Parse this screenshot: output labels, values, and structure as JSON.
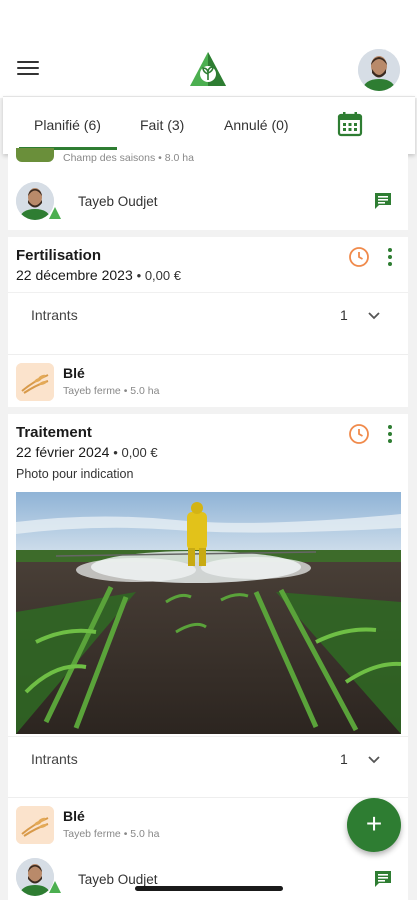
{
  "tabs": [
    {
      "label": "Planifié (6)",
      "active": true
    },
    {
      "label": "Fait (3)",
      "active": false
    },
    {
      "label": "Annulé (0)",
      "active": false
    }
  ],
  "top_partial": {
    "crop_meta": "Champ des saisons • 8.0 ha",
    "user_name": "Tayeb  Oudjet"
  },
  "cards": [
    {
      "title": "Fertilisation",
      "date": "22 décembre 2023",
      "amount": "• 0,00 €",
      "intrants_label": "Intrants",
      "intrants_count": "1",
      "crop_name": "Blé",
      "crop_meta": "Tayeb ferme • 5.0 ha"
    },
    {
      "title": "Traitement",
      "date": "22 février 2024",
      "amount": "• 0,00 €",
      "note": "Photo pour indication",
      "intrants_label": "Intrants",
      "intrants_count": "1",
      "crop_name": "Blé",
      "crop_meta": "Tayeb ferme • 5.0 ha",
      "user_name": "Tayeb  Oudjet"
    }
  ],
  "fab_label": "+",
  "colors": {
    "primary": "#2e7d32",
    "clock": "#f08a4b",
    "logo": "#4caf50"
  },
  "icons": [
    "menu-icon",
    "logo-icon",
    "calendar-icon",
    "chat-icon",
    "clock-icon",
    "more-vert-icon",
    "chevron-down-icon",
    "add-icon"
  ]
}
